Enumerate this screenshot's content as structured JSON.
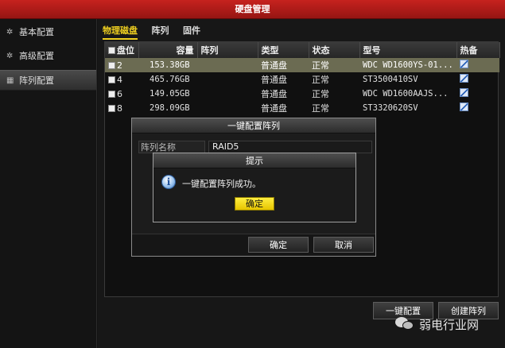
{
  "window": {
    "title": "硬盘管理"
  },
  "sidebar": {
    "items": [
      {
        "label": "基本配置",
        "icon": "gear-icon"
      },
      {
        "label": "高级配置",
        "icon": "gear-icon"
      },
      {
        "label": "阵列配置",
        "icon": "grid-icon",
        "active": true
      }
    ]
  },
  "tabs": [
    {
      "label": "物理磁盘",
      "active": true
    },
    {
      "label": "阵列"
    },
    {
      "label": "固件"
    }
  ],
  "table": {
    "headers": [
      "盘位",
      "容量",
      "阵列",
      "类型",
      "状态",
      "型号",
      "热备"
    ],
    "rows": [
      {
        "slot": "2",
        "capacity": "153.38GB",
        "array": "",
        "type": "普通盘",
        "status": "正常",
        "model": "WDC WD1600YS-01...",
        "selected": true
      },
      {
        "slot": "4",
        "capacity": "465.76GB",
        "array": "",
        "type": "普通盘",
        "status": "正常",
        "model": "ST3500410SV"
      },
      {
        "slot": "6",
        "capacity": "149.05GB",
        "array": "",
        "type": "普通盘",
        "status": "正常",
        "model": "WDC WD1600AAJS..."
      },
      {
        "slot": "8",
        "capacity": "298.09GB",
        "array": "",
        "type": "普通盘",
        "status": "正常",
        "model": "ST3320620SV"
      }
    ]
  },
  "dialog_one_key": {
    "title": "一键配置阵列",
    "field_label": "阵列名称",
    "field_value": "RAID5",
    "ok_label": "确定",
    "cancel_label": "取消"
  },
  "dialog_prompt": {
    "title": "提示",
    "message": "一键配置阵列成功。",
    "ok_label": "确定"
  },
  "bottom_buttons": {
    "one_key_label": "一键配置",
    "create_label": "创建阵列"
  },
  "watermark": {
    "text": "弱电行业网"
  },
  "colors": {
    "title_red": "#b51b18",
    "tab_accent": "#f0d020",
    "selected_row": "#6b6b52",
    "ok_yellow": "#f5dc20"
  }
}
